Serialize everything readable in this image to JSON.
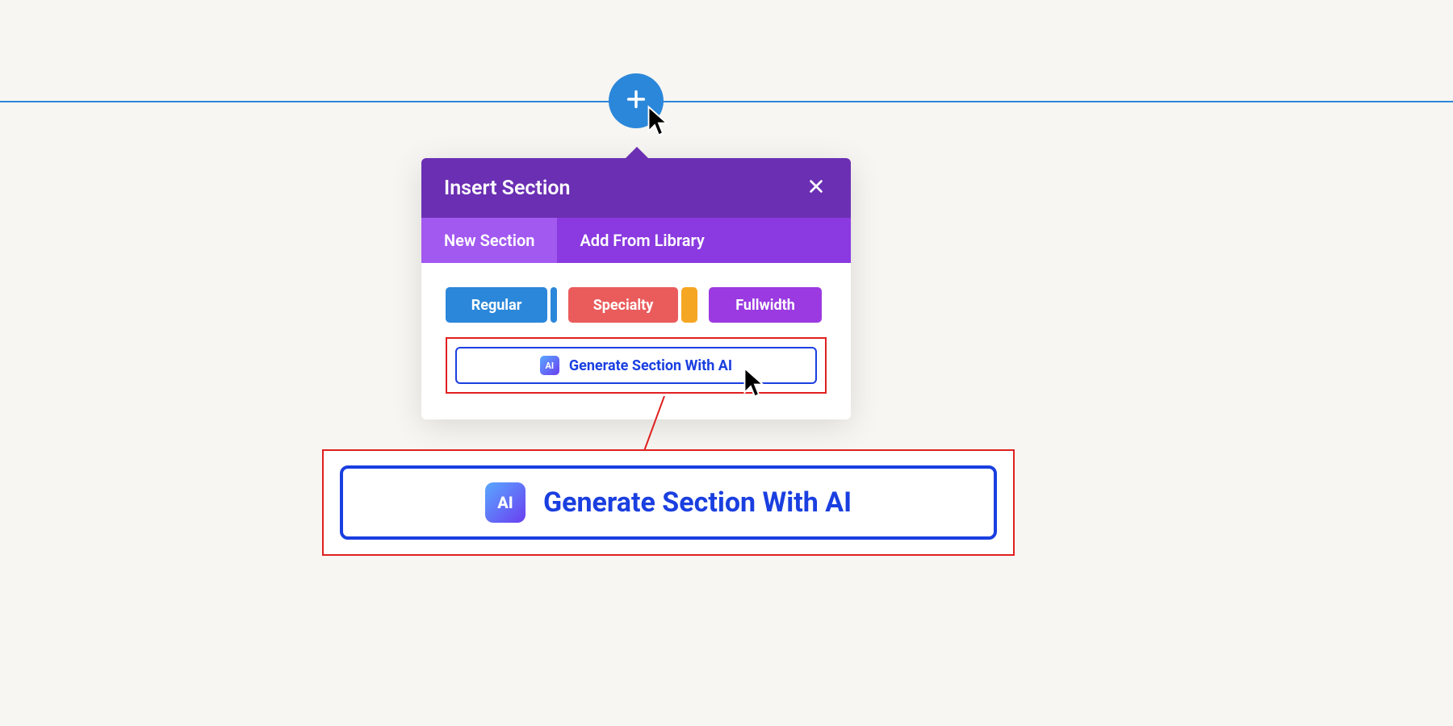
{
  "popover": {
    "title": "Insert Section",
    "close_icon": "close-icon"
  },
  "tabs": {
    "new_section": "New Section",
    "add_from_library": "Add From Library"
  },
  "types": {
    "regular": "Regular",
    "specialty": "Specialty",
    "fullwidth": "Fullwidth"
  },
  "ai": {
    "icon_text": "AI",
    "label": "Generate Section With AI"
  },
  "colors": {
    "blue": "#2b87da",
    "purple_dark": "#6b2fb3",
    "purple_tab": "#8a3ae0",
    "purple_tab_active": "#a259f0",
    "red_type": "#ea5c5c",
    "orange_side": "#f5a623",
    "purple_type": "#9b3ae0",
    "ai_blue": "#1a3fe0",
    "callout_red": "#e02020"
  }
}
